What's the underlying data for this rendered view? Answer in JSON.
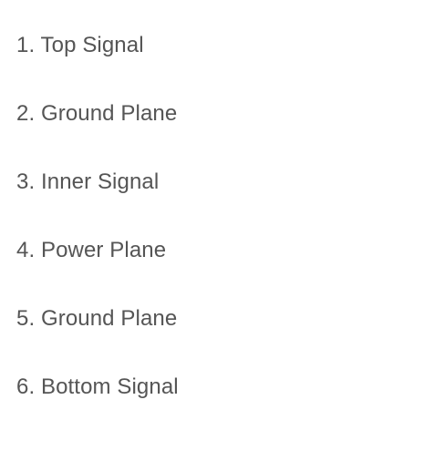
{
  "layers": [
    {
      "label": "1. Top Signal"
    },
    {
      "label": "2. Ground Plane"
    },
    {
      "label": "3. Inner Signal"
    },
    {
      "label": "4. Power Plane"
    },
    {
      "label": "5. Ground Plane"
    },
    {
      "label": "6. Bottom Signal"
    }
  ],
  "colors": {
    "text": "#555555",
    "background": "#ffffff"
  }
}
